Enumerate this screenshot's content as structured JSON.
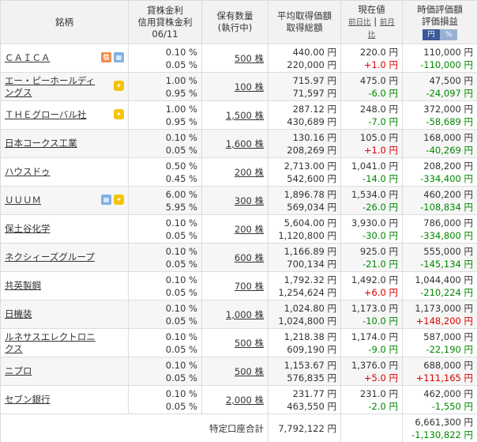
{
  "header": {
    "name": "銘柄",
    "rates_line1": "貸株金利",
    "rates_line2": "信用貸株金利",
    "rates_line3": "06/11",
    "qty_line1": "保有数量",
    "qty_line2": "(執行中)",
    "avg_line1": "平均取得価額",
    "avg_line2": "取得総額",
    "cur_line1": "現在値",
    "cur_prev_day": "前日比",
    "cur_prev_month": "前月比",
    "cur_sep": " | ",
    "val_line1": "時価評価額",
    "val_line2": "評価損益",
    "toggle_yen": "円",
    "toggle_pct": "%"
  },
  "colors": {
    "gain": "#dd0000",
    "loss": "#008800",
    "header_bg": "#f2f2f2",
    "toggle_on": "#3a5a9a",
    "toggle_off": "#9ab0d3"
  },
  "rows": [
    {
      "name": "ＣＡＩＣＡ",
      "badges": [
        "orange",
        "blue"
      ],
      "rate1": "0.10 %",
      "rate2": "0.05 %",
      "qty": "500 株",
      "avg": "440.00 円",
      "total": "220,000 円",
      "price": "220.0 円",
      "change": "+1.0 円",
      "change_dir": "pos",
      "value": "110,000 円",
      "pl": "-110,000 円",
      "pl_dir": "neg"
    },
    {
      "name": "エー・ピーホールディングス",
      "badges": [
        "yellow"
      ],
      "rate1": "1.00 %",
      "rate2": "0.95 %",
      "qty": "100 株",
      "avg": "715.97 円",
      "total": "71,597 円",
      "price": "475.0 円",
      "change": "-6.0 円",
      "change_dir": "neg",
      "value": "47,500 円",
      "pl": "-24,097 円",
      "pl_dir": "neg"
    },
    {
      "name": "ＴＨＥグローバル社",
      "badges": [
        "yellow"
      ],
      "rate1": "1.00 %",
      "rate2": "0.95 %",
      "qty": "1,500 株",
      "avg": "287.12 円",
      "total": "430,689 円",
      "price": "248.0 円",
      "change": "-7.0 円",
      "change_dir": "neg",
      "value": "372,000 円",
      "pl": "-58,689 円",
      "pl_dir": "neg"
    },
    {
      "name": "日本コークス工業",
      "badges": [],
      "rate1": "0.10 %",
      "rate2": "0.05 %",
      "qty": "1,600 株",
      "avg": "130.16 円",
      "total": "208,269 円",
      "price": "105.0 円",
      "change": "+1.0 円",
      "change_dir": "pos",
      "value": "168,000 円",
      "pl": "-40,269 円",
      "pl_dir": "neg"
    },
    {
      "name": "ハウスドゥ",
      "badges": [],
      "rate1": "0.50 %",
      "rate2": "0.45 %",
      "qty": "200 株",
      "avg": "2,713.00 円",
      "total": "542,600 円",
      "price": "1,041.0 円",
      "change": "-14.0 円",
      "change_dir": "neg",
      "value": "208,200 円",
      "pl": "-334,400 円",
      "pl_dir": "neg"
    },
    {
      "name": "ＵＵＵＭ",
      "badges": [
        "blue",
        "yellow"
      ],
      "rate1": "6.00 %",
      "rate2": "5.95 %",
      "qty": "300 株",
      "avg": "1,896.78 円",
      "total": "569,034 円",
      "price": "1,534.0 円",
      "change": "-26.0 円",
      "change_dir": "neg",
      "value": "460,200 円",
      "pl": "-108,834 円",
      "pl_dir": "neg"
    },
    {
      "name": "保土谷化学",
      "badges": [],
      "rate1": "0.10 %",
      "rate2": "0.05 %",
      "qty": "200 株",
      "avg": "5,604.00 円",
      "total": "1,120,800 円",
      "price": "3,930.0 円",
      "change": "-30.0 円",
      "change_dir": "neg",
      "value": "786,000 円",
      "pl": "-334,800 円",
      "pl_dir": "neg"
    },
    {
      "name": "ネクシィーズグループ",
      "badges": [],
      "rate1": "0.10 %",
      "rate2": "0.05 %",
      "qty": "600 株",
      "avg": "1,166.89 円",
      "total": "700,134 円",
      "price": "925.0 円",
      "change": "-21.0 円",
      "change_dir": "neg",
      "value": "555,000 円",
      "pl": "-145,134 円",
      "pl_dir": "neg"
    },
    {
      "name": "共英製鋼",
      "badges": [],
      "rate1": "0.10 %",
      "rate2": "0.05 %",
      "qty": "700 株",
      "avg": "1,792.32 円",
      "total": "1,254,624 円",
      "price": "1,492.0 円",
      "change": "+6.0 円",
      "change_dir": "pos",
      "value": "1,044,400 円",
      "pl": "-210,224 円",
      "pl_dir": "neg"
    },
    {
      "name": "日機装",
      "badges": [],
      "rate1": "0.10 %",
      "rate2": "0.05 %",
      "qty": "1,000 株",
      "avg": "1,024.80 円",
      "total": "1,024,800 円",
      "price": "1,173.0 円",
      "change": "-10.0 円",
      "change_dir": "neg",
      "value": "1,173,000 円",
      "pl": "+148,200 円",
      "pl_dir": "pos"
    },
    {
      "name": "ルネサスエレクトロニクス",
      "badges": [],
      "rate1": "0.10 %",
      "rate2": "0.05 %",
      "qty": "500 株",
      "avg": "1,218.38 円",
      "total": "609,190 円",
      "price": "1,174.0 円",
      "change": "-9.0 円",
      "change_dir": "neg",
      "value": "587,000 円",
      "pl": "-22,190 円",
      "pl_dir": "neg"
    },
    {
      "name": "ニプロ",
      "badges": [],
      "rate1": "0.10 %",
      "rate2": "0.05 %",
      "qty": "500 株",
      "avg": "1,153.67 円",
      "total": "576,835 円",
      "price": "1,376.0 円",
      "change": "+5.0 円",
      "change_dir": "pos",
      "value": "688,000 円",
      "pl": "+111,165 円",
      "pl_dir": "pos"
    },
    {
      "name": "セブン銀行",
      "badges": [],
      "rate1": "0.10 %",
      "rate2": "0.05 %",
      "qty": "2,000 株",
      "avg": "231.77 円",
      "total": "463,550 円",
      "price": "231.0 円",
      "change": "-2.0 円",
      "change_dir": "neg",
      "value": "462,000 円",
      "pl": "-1,550 円",
      "pl_dir": "neg"
    }
  ],
  "totals": {
    "label": "特定口座合計",
    "acquisition_total": "7,792,122 円",
    "value_total": "6,661,300 円",
    "pl_total": "-1,130,822 円"
  }
}
